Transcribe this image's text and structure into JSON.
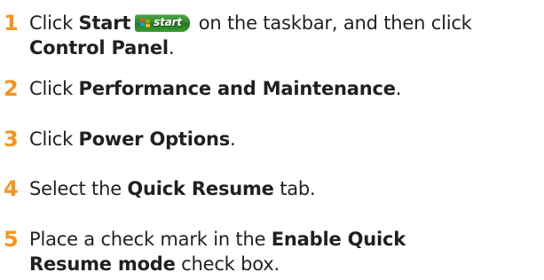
{
  "accent_color": "#f7941d",
  "steps": [
    {
      "number": "1",
      "parts": {
        "a": "Click ",
        "b": "Start",
        "start_button_label": "start",
        "c": " on the taskbar, and then click",
        "d": "Control Panel",
        "e": "."
      }
    },
    {
      "number": "2",
      "parts": {
        "a": "Click ",
        "b": "Performance and Maintenance",
        "c": "."
      }
    },
    {
      "number": "3",
      "parts": {
        "a": "Click ",
        "b": "Power Options",
        "c": "."
      }
    },
    {
      "number": "4",
      "parts": {
        "a": "Select the ",
        "b": "Quick Resume",
        "c": " tab."
      }
    },
    {
      "number": "5",
      "parts": {
        "a": "Place a check mark in the ",
        "b": "Enable Quick",
        "d": "Resume mode",
        "e": " check box."
      }
    }
  ],
  "icons": {
    "start_flag": "windows-flag-icon"
  }
}
